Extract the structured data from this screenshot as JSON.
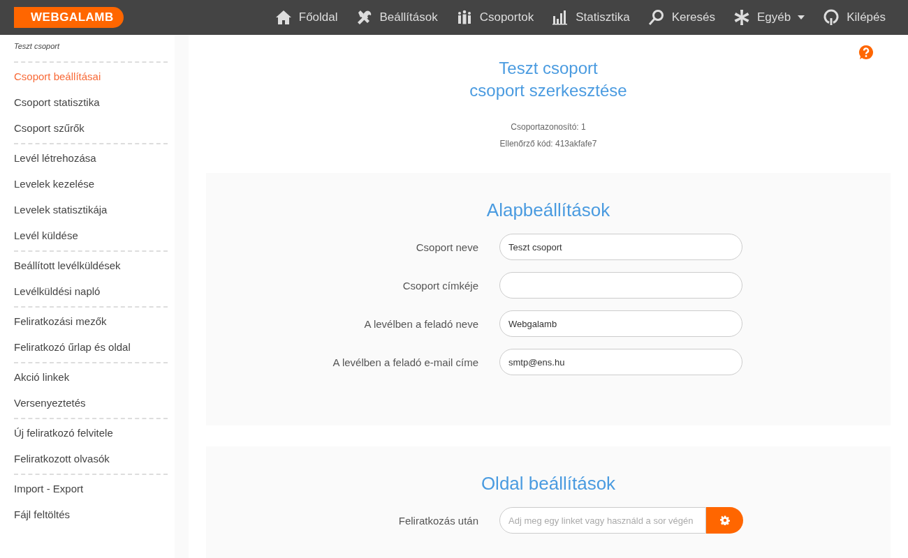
{
  "brand": {
    "logo": "WEBGALAMB"
  },
  "nav": [
    {
      "kind": "home",
      "label": "Főoldal"
    },
    {
      "kind": "tools",
      "label": "Beállítások"
    },
    {
      "kind": "people",
      "label": "Csoportok"
    },
    {
      "kind": "chart",
      "label": "Statisztika"
    },
    {
      "kind": "search",
      "label": "Keresés"
    },
    {
      "kind": "star",
      "label": "Egyéb",
      "dropdown": true
    },
    {
      "kind": "logout",
      "label": "Kilépés"
    }
  ],
  "sidebar": {
    "heading": "Teszt csoport",
    "groups": [
      [
        {
          "label": "Csoport beállításai",
          "selected": true
        },
        {
          "label": "Csoport statisztika",
          "selected": false
        },
        {
          "label": "Csoport szűrők",
          "selected": false
        }
      ],
      [
        {
          "label": "Levél létrehozása",
          "selected": false
        },
        {
          "label": "Levelek kezelése",
          "selected": false
        },
        {
          "label": "Levelek statisztikája",
          "selected": false
        },
        {
          "label": "Levél küldése",
          "selected": false
        }
      ],
      [
        {
          "label": "Beállított levélküldések",
          "selected": false
        },
        {
          "label": "Levélküldési napló",
          "selected": false
        }
      ],
      [
        {
          "label": "Feliratkozási mezők",
          "selected": false
        },
        {
          "label": "Feliratkozó űrlap és oldal",
          "selected": false
        }
      ],
      [
        {
          "label": "Akció linkek",
          "selected": false
        },
        {
          "label": "Versenyeztetés",
          "selected": false
        }
      ],
      [
        {
          "label": "Új feliratkozó felvitele",
          "selected": false
        },
        {
          "label": "Feliratkozott olvasók",
          "selected": false
        }
      ],
      [
        {
          "label": "Import - Export",
          "selected": false
        },
        {
          "label": "Fájl feltöltés",
          "selected": false
        }
      ]
    ]
  },
  "page": {
    "title": "Teszt csoport",
    "subtitle": "csoport szerkesztése",
    "info": [
      "Csoportazonosító: 1",
      "Ellenőrző kód: 413akfafe7"
    ]
  },
  "sections": [
    {
      "title": "Alapbeállítások",
      "fields": [
        {
          "kind": "text",
          "label": "Csoport neve",
          "value": "Teszt csoport"
        },
        {
          "kind": "text",
          "label": "Csoport címkéje"
        },
        {
          "kind": "text",
          "label": "A levélben a feladó neve",
          "value": "Webgalamb"
        },
        {
          "kind": "text",
          "label": "A levélben a feladó e-mail címe",
          "value": "smtp@ens.hu"
        }
      ]
    },
    {
      "title": "Oldal beállítások",
      "fields": [
        {
          "kind": "link",
          "label": "Feliratkozás után",
          "placeholder": "Adj meg egy linket vagy használd a sor végén"
        }
      ]
    }
  ]
}
